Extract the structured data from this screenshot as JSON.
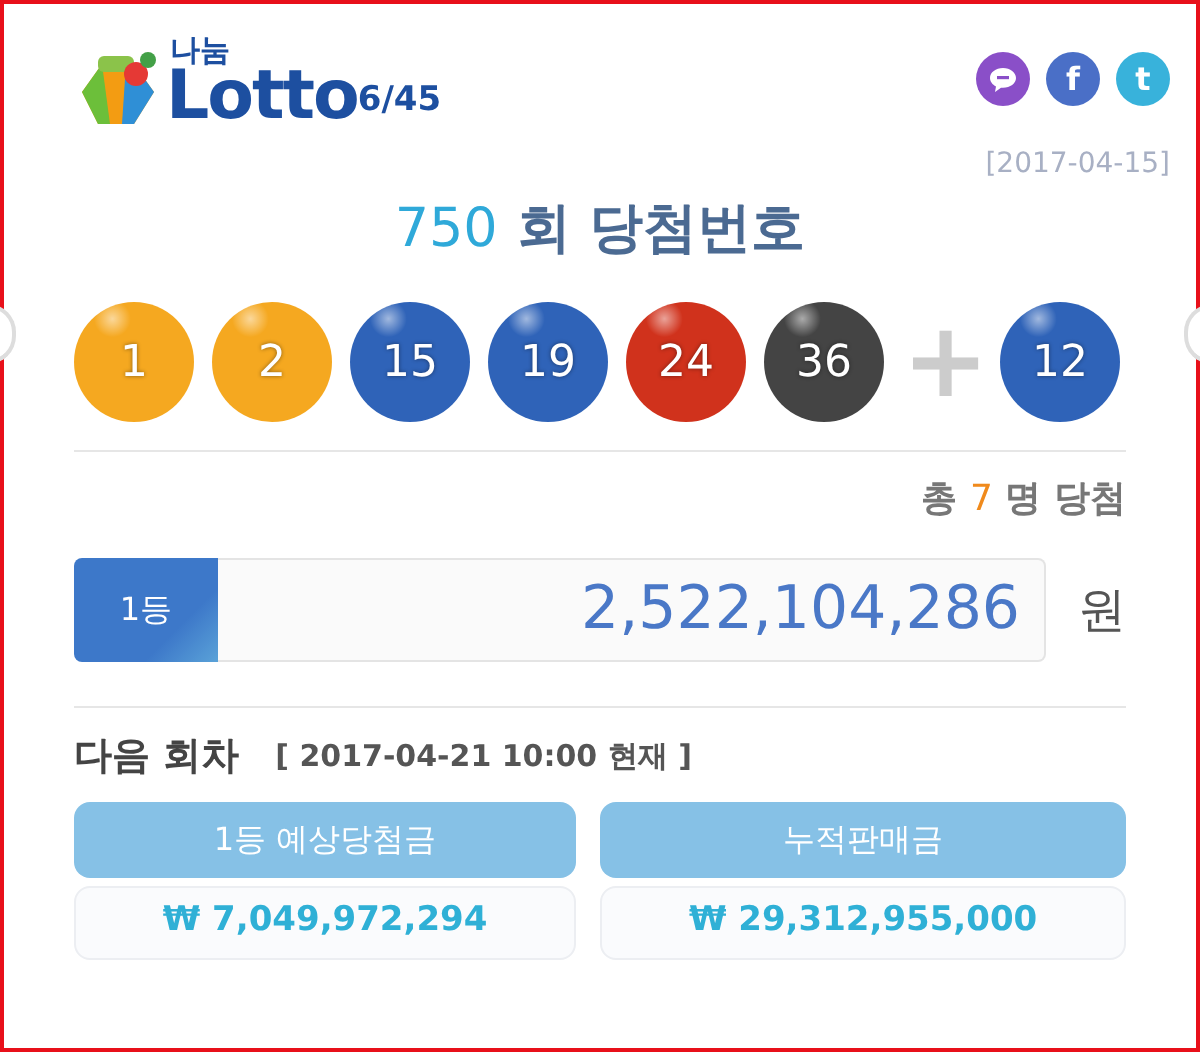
{
  "logo": {
    "small": "나눔",
    "main": "Lotto",
    "suffix": "6/45"
  },
  "share": [
    {
      "kind": "bubble",
      "color": "#8a4fc8"
    },
    {
      "kind": "letter",
      "glyph": "f",
      "color": "#4a6fc7"
    },
    {
      "kind": "letter",
      "glyph": "t",
      "color": "#38b2db"
    }
  ],
  "date": "[2017-04-15]",
  "title": {
    "round": "750",
    "text": "회 당첨번호"
  },
  "balls": [
    {
      "number": "1",
      "color": "#f5a820"
    },
    {
      "number": "2",
      "color": "#f5a820"
    },
    {
      "number": "15",
      "color": "#2f63b8"
    },
    {
      "number": "19",
      "color": "#2f63b8"
    },
    {
      "number": "24",
      "color": "#d0321c"
    },
    {
      "number": "36",
      "color": "#444444"
    }
  ],
  "plus": "+",
  "bonus": {
    "number": "12",
    "color": "#2f63b8"
  },
  "winners": {
    "prefix": "총",
    "count": "7",
    "suffix": "명 당첨"
  },
  "prize": {
    "rank": "1등",
    "amount": "2,522,104,286",
    "unit": "원"
  },
  "next": {
    "label": "다음 회차",
    "stamp": "[ 2017-04-21 10:00 현재 ]"
  },
  "stats": [
    {
      "label": "1등 예상당첨금",
      "value": "₩ 7,049,972,294"
    },
    {
      "label": "누적판매금",
      "value": "₩ 29,312,955,000"
    }
  ]
}
